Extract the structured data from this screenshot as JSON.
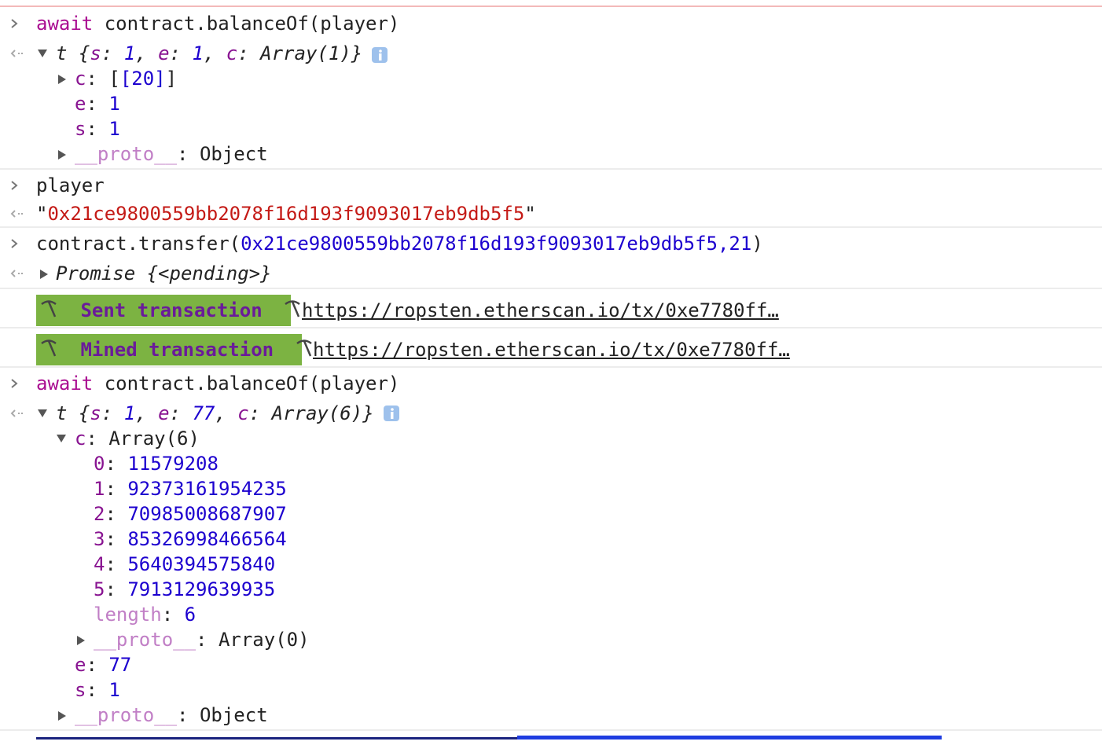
{
  "console": {
    "entries": [
      {
        "input_keyword": "await",
        "input_rest": " contract.balanceOf(player)"
      },
      {
        "result_summary": {
          "type": "t",
          "s": "1",
          "e": "1",
          "c": "Array(1)"
        }
      },
      {
        "c_value": "[20]",
        "e_value": "1",
        "s_value": "1",
        "proto_label": "__proto__",
        "proto_value": "Object"
      },
      {
        "input": "player"
      },
      {
        "result_string": "0x21ce9800559bb2078f16d193f9093017eb9db5f5"
      },
      {
        "input_prefix": "contract.transfer(",
        "input_arg_address": "0x21ce9800559bb2078f16d193f9093017eb9db5f5",
        "input_comma": ",",
        "input_arg_amount": "21",
        "input_suffix": ")"
      },
      {
        "result_promise": "Promise",
        "result_promise_state": "{<pending>}"
      }
    ],
    "sent": {
      "label": "Sent transaction",
      "link": "https://ropsten.etherscan.io/tx/0xe7780ff…"
    },
    "mined": {
      "label": "Mined transaction",
      "link": "https://ropsten.etherscan.io/tx/0xe7780ff…"
    },
    "second_call": {
      "input_keyword": "await",
      "input_rest": " contract.balanceOf(player)"
    },
    "second_result": {
      "type": "t",
      "s": "1",
      "e": "77",
      "c": "Array(6)",
      "c_label": "Array(6)",
      "items": [
        {
          "index": "0",
          "value": "11579208"
        },
        {
          "index": "1",
          "value": "92373161954235"
        },
        {
          "index": "2",
          "value": "70985008687907"
        },
        {
          "index": "3",
          "value": "85326998466564"
        },
        {
          "index": "4",
          "value": "5640394575840"
        },
        {
          "index": "5",
          "value": "7913129639935"
        }
      ],
      "length_label": "length",
      "length_value": "6",
      "array_proto_label": "__proto__",
      "array_proto_value": "Array(0)",
      "e_value": "77",
      "s_value": "1",
      "proto_label": "__proto__",
      "proto_value": "Object"
    }
  },
  "colors": {
    "keyword": "#aa0d91",
    "property": "#881391",
    "number": "#1c00cf",
    "string": "#c41a16",
    "badge_bg": "#7cb342",
    "badge_text": "#6a1b9a"
  },
  "icons": {
    "input": "chevron-right-icon",
    "output": "return-arrow-icon",
    "expand": "triangle-right-icon",
    "collapse": "triangle-down-icon",
    "info": "info-icon",
    "pickaxe": "pickaxe-icon"
  }
}
